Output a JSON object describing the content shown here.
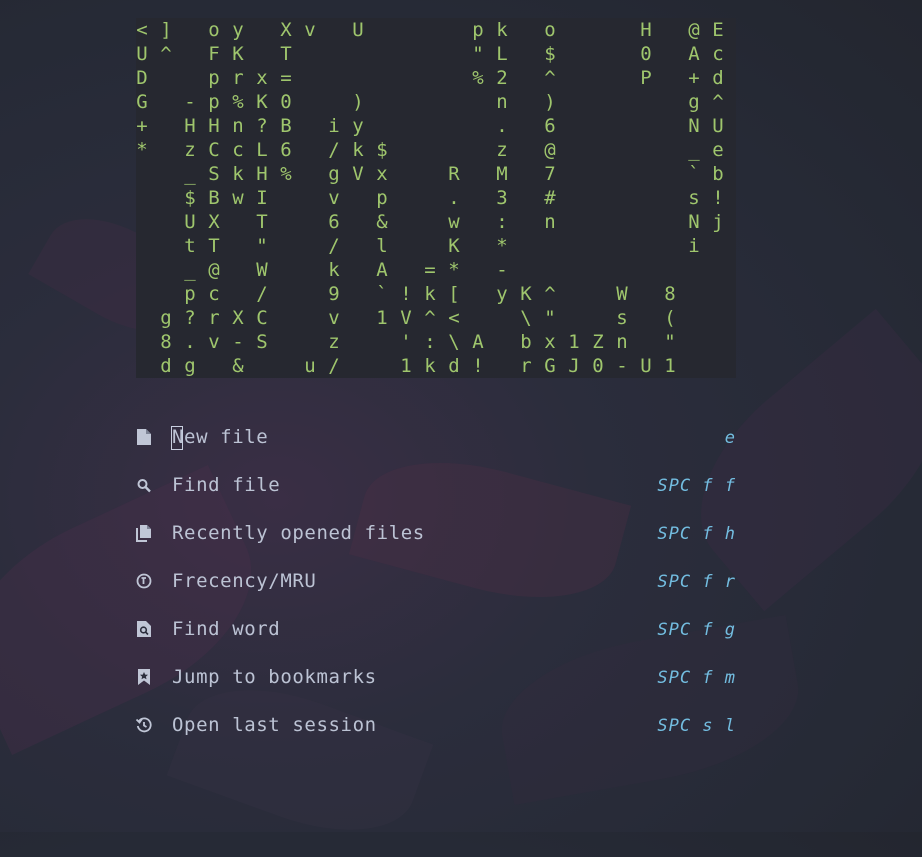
{
  "rain": {
    "rows": [
      [
        "<",
        "]",
        "",
        "o",
        "y",
        "",
        "X",
        "v",
        "",
        "U",
        "",
        "",
        "",
        "",
        "p",
        "k",
        "",
        "o",
        "",
        "",
        "",
        "H",
        "",
        "@",
        "E"
      ],
      [
        "U",
        "^",
        "",
        "F",
        "K",
        "",
        "T",
        "",
        "",
        "",
        "",
        "",
        "",
        "",
        "\"",
        "L",
        "",
        "$",
        "",
        "",
        "",
        "0",
        "",
        "A",
        "c"
      ],
      [
        "D",
        "",
        "",
        "p",
        "r",
        "x",
        "=",
        "",
        "",
        "",
        "",
        "",
        "",
        "",
        "%",
        "2",
        "",
        "^",
        "",
        "",
        "",
        "P",
        "",
        "+",
        "d"
      ],
      [
        "G",
        "",
        "-",
        "p",
        "%",
        "K",
        "0",
        "",
        "",
        ")",
        "",
        "",
        "",
        "",
        "",
        "n",
        "",
        ")",
        "",
        "",
        "",
        "",
        "",
        "g",
        "^"
      ],
      [
        "+",
        "",
        "H",
        "H",
        "n",
        "?",
        "B",
        "",
        "i",
        "y",
        "",
        "",
        "",
        "",
        "",
        ".",
        "",
        "6",
        "",
        "",
        "",
        "",
        "",
        "N",
        "U"
      ],
      [
        "*",
        "",
        "z",
        "C",
        "c",
        "L",
        "6",
        "",
        "/",
        "k",
        "$",
        "",
        "",
        "",
        "",
        "z",
        "",
        "@",
        "",
        "",
        "",
        "",
        "",
        "_",
        "e"
      ],
      [
        "",
        "",
        "_",
        "S",
        "k",
        "H",
        "%",
        "",
        "g",
        "V",
        "x",
        "",
        "",
        "R",
        "",
        "M",
        "",
        "7",
        "",
        "",
        "",
        "",
        "",
        "`",
        "b"
      ],
      [
        "",
        "",
        "$",
        "B",
        "w",
        "I",
        "",
        "",
        "v",
        "",
        "p",
        "",
        "",
        ".",
        "",
        "3",
        "",
        "#",
        "",
        "",
        "",
        "",
        "",
        "s",
        "!"
      ],
      [
        "",
        "",
        "U",
        "X",
        "",
        "T",
        "",
        "",
        "6",
        "",
        "&",
        "",
        "",
        "w",
        "",
        ":",
        "",
        "n",
        "",
        "",
        "",
        "",
        "",
        "N",
        "j"
      ],
      [
        "",
        "",
        "t",
        "T",
        "",
        "\"",
        "",
        "",
        "/",
        "",
        "l",
        "",
        "",
        "K",
        "",
        "*",
        "",
        "",
        "",
        "",
        "",
        "",
        "",
        "i",
        ""
      ],
      [
        "",
        "",
        "_",
        "@",
        "",
        "W",
        "",
        "",
        "k",
        "",
        "A",
        "",
        "=",
        "*",
        "",
        "-",
        "",
        "",
        "",
        "",
        "",
        "",
        "",
        "",
        ""
      ],
      [
        "",
        "",
        "p",
        "c",
        "",
        "/",
        "",
        "",
        "9",
        "",
        "`",
        "!",
        "k",
        "[",
        "",
        "y",
        "K",
        "^",
        "",
        "",
        "W",
        "",
        "8",
        "",
        ""
      ],
      [
        "",
        "g",
        "?",
        "r",
        "X",
        "C",
        "",
        "",
        "v",
        "",
        "1",
        "V",
        "^",
        "<",
        "",
        "",
        "\\",
        "\"",
        "",
        "",
        "s",
        "",
        "(",
        "",
        ""
      ],
      [
        "",
        "8",
        ".",
        "v",
        "-",
        "S",
        "",
        "",
        "z",
        "",
        "",
        "'",
        ":",
        "\\",
        "A",
        "",
        "b",
        "x",
        "1",
        "Z",
        "n",
        "",
        "\"",
        "",
        ""
      ],
      [
        "",
        "d",
        "g",
        "",
        "&",
        "",
        "",
        "u",
        "/",
        "",
        "",
        "1",
        "k",
        "d",
        "!",
        "",
        "r",
        "G",
        "J",
        "0",
        "-",
        "U",
        "1",
        "",
        ""
      ]
    ]
  },
  "menu": [
    {
      "label": "New file",
      "key": "e",
      "icon": "file-icon"
    },
    {
      "label": "Find file",
      "key": "SPC f f",
      "icon": "search-icon"
    },
    {
      "label": "Recently opened files",
      "key": "SPC f h",
      "icon": "files-icon"
    },
    {
      "label": "Frecency/MRU",
      "key": "SPC f r",
      "icon": "history-icon"
    },
    {
      "label": "Find word",
      "key": "SPC f g",
      "icon": "file-search-icon"
    },
    {
      "label": "Jump to bookmarks",
      "key": "SPC f m",
      "icon": "bookmark-icon"
    },
    {
      "label": "Open last session",
      "key": "SPC s l",
      "icon": "restore-icon"
    }
  ],
  "colors": {
    "rain": "#9fc66d",
    "label": "#bcc3d4",
    "key": "#73bde0",
    "icon": "#c0c6d6"
  }
}
